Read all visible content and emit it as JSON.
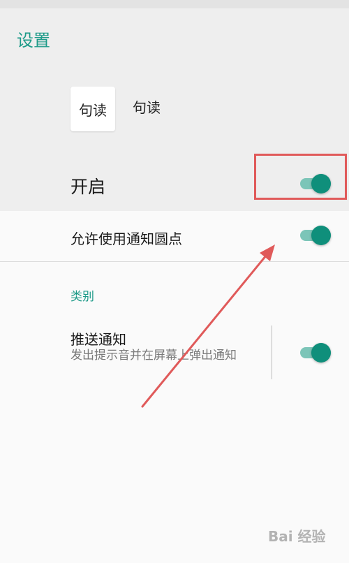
{
  "page": {
    "title": "设置"
  },
  "app": {
    "icon_text": "句读",
    "name": "句读"
  },
  "settings": {
    "enable_label": "开启",
    "enable_on": true,
    "notification_dot_label": "允许使用通知圆点",
    "notification_dot_on": true,
    "category_header": "类别",
    "push": {
      "title": "推送通知",
      "description": "发出提示音并在屏幕上弹出通知",
      "on": true
    }
  },
  "colors": {
    "accent": "#1c9a88",
    "toggle_thumb": "#0f8f7b",
    "toggle_track": "#7cc5b8",
    "annotation": "#e05a5a"
  },
  "watermark": {
    "text": "Bai 经验"
  }
}
